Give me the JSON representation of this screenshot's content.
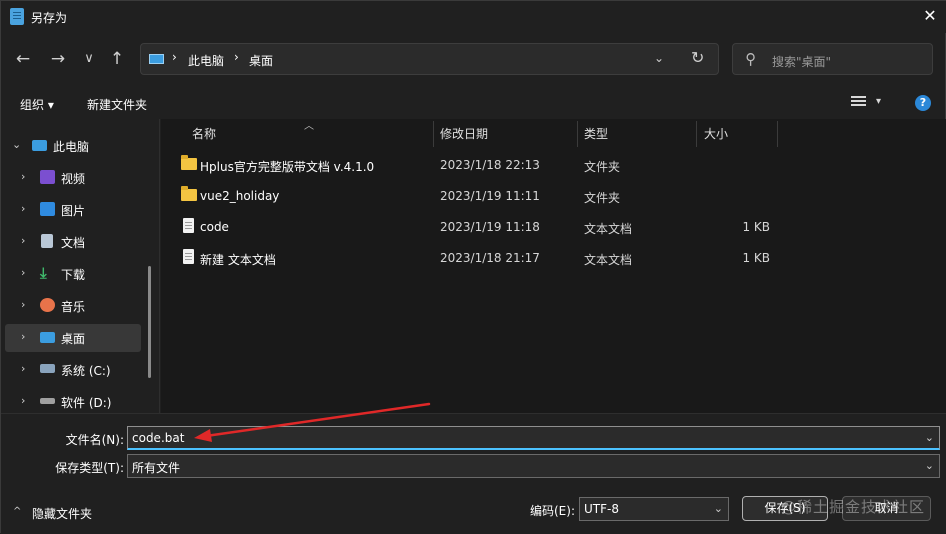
{
  "window": {
    "title": "另存为"
  },
  "nav": {
    "back": "←",
    "forward": "→",
    "recent": "∨",
    "up": "↑",
    "breadcrumb": [
      "此电脑",
      "桌面"
    ],
    "search_placeholder": "搜索\"桌面\""
  },
  "toolbar": {
    "organize": "组织 ▾",
    "new_folder": "新建文件夹",
    "help": "?"
  },
  "sidebar": {
    "items": [
      {
        "label": "此电脑",
        "icon": "pc-icon",
        "expanded": true
      },
      {
        "label": "视频",
        "icon": "video-icon"
      },
      {
        "label": "图片",
        "icon": "picture-icon"
      },
      {
        "label": "文档",
        "icon": "document-icon"
      },
      {
        "label": "下载",
        "icon": "download-icon"
      },
      {
        "label": "音乐",
        "icon": "music-icon"
      },
      {
        "label": "桌面",
        "icon": "desktop-icon",
        "selected": true
      },
      {
        "label": "系统 (C:)",
        "icon": "drive-c-icon"
      },
      {
        "label": "软件 (D:)",
        "icon": "drive-d-icon"
      }
    ]
  },
  "files": {
    "columns": [
      "名称",
      "修改日期",
      "类型",
      "大小"
    ],
    "rows": [
      {
        "name": "Hplus官方完整版带文档 v.4.1.0",
        "date": "2023/1/18 22:13",
        "type": "文件夹",
        "size": "",
        "icon": "folder-icon"
      },
      {
        "name": "vue2_holiday",
        "date": "2023/1/19 11:11",
        "type": "文件夹",
        "size": "",
        "icon": "folder-icon"
      },
      {
        "name": "code",
        "date": "2023/1/19 11:18",
        "type": "文本文档",
        "size": "1 KB",
        "icon": "text-file-icon"
      },
      {
        "name": "新建 文本文档",
        "date": "2023/1/18 21:17",
        "type": "文本文档",
        "size": "1 KB",
        "icon": "text-file-icon"
      }
    ]
  },
  "save": {
    "filename_label": "文件名(N):",
    "filename_value": "code.bat",
    "filetype_label": "保存类型(T):",
    "filetype_value": "所有文件",
    "encoding_label": "编码(E):",
    "encoding_value": "UTF-8",
    "hide_folders": "隐藏文件夹",
    "save_button": "保存(S)",
    "cancel_button": "取消"
  },
  "watermark": "@稀土掘金技术社区",
  "colors": {
    "accent": "#4cc2ff",
    "annotation_arrow": "#e02828",
    "folder": "#f4c542"
  }
}
